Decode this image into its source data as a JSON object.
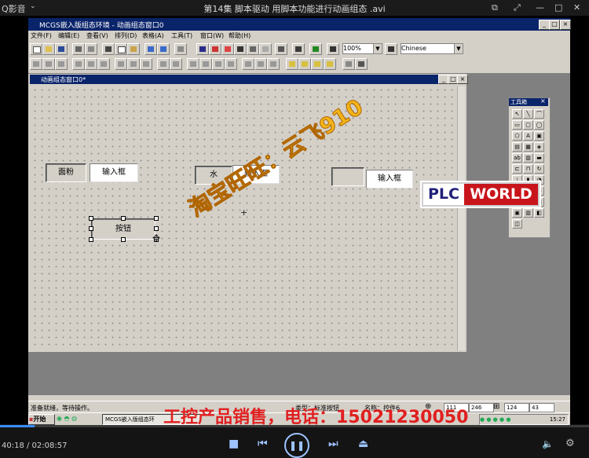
{
  "player": {
    "title": "第14集 脚本驱动 用脚本功能进行动画组态 .avi",
    "brand": "Q影音",
    "time": "40:18 / 02:08:57",
    "progress_fraction": 0.0058
  },
  "app": {
    "title": "MCGS嵌入版组态环境 - 动画组态窗口0",
    "menu": [
      "文件(F)",
      "编辑(E)",
      "查看(V)",
      "排列(D)",
      "表格(A)",
      "工具(T)",
      "窗口(W)",
      "帮助(H)"
    ],
    "zoom": "100%",
    "language": "Chinese"
  },
  "child_window": {
    "title": "动画组态窗口0*"
  },
  "canvas": {
    "label1": "面粉",
    "input1": "输入框",
    "label2": "水",
    "input2": "输入框",
    "label3": "",
    "input3": "输入框",
    "button": "按钮"
  },
  "toolbox": {
    "title": "工具箱"
  },
  "status": {
    "ready": "准备就绪，等待操作。",
    "type": "类型：标准按钮",
    "name": "名称：控件6",
    "x": "111",
    "y": "246",
    "w": "124",
    "h": "43"
  },
  "taskbar": {
    "start": "开始",
    "task": "MCGS嵌入版组态环",
    "clock": "15:27"
  },
  "watermarks": {
    "taobao": "淘宝旺旺：云飞910",
    "plc_a": "PLC",
    "plc_b": "WORLD",
    "sales": "工控产品销售，电话：15021230050"
  },
  "colors": {
    "title_blue": "#0a246a",
    "face": "#d4d0c8",
    "player_accent": "#3b8cff",
    "plc_red": "#c8151b",
    "taobao_yellow": "#f2b51a"
  }
}
